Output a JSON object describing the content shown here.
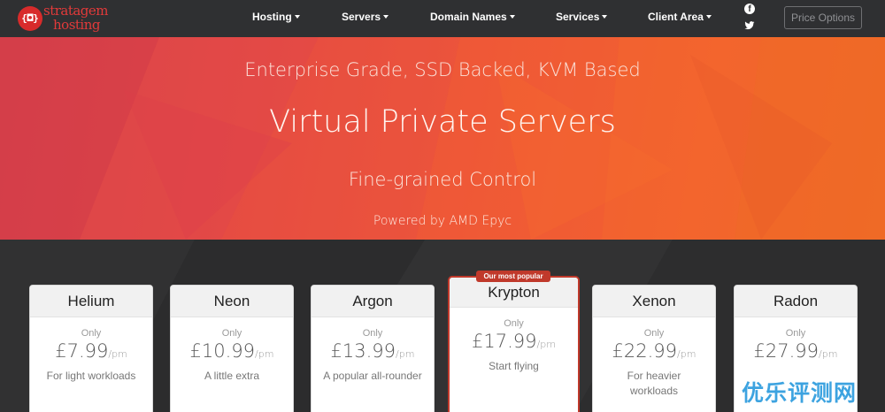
{
  "brand": {
    "name_line1": "stratagem",
    "name_line2": "hosting",
    "mark": "{◘}"
  },
  "nav": {
    "items": [
      {
        "label": "Hosting"
      },
      {
        "label": "Servers"
      },
      {
        "label": "Domain Names"
      },
      {
        "label": "Services"
      },
      {
        "label": "Client Area"
      }
    ],
    "social": [
      {
        "icon": "facebook-icon",
        "glyph": "f"
      },
      {
        "icon": "twitter-icon"
      }
    ],
    "price_options_label": "Price Options"
  },
  "hero": {
    "tagline": "Enterprise Grade, SSD Backed, KVM Based",
    "title": "Virtual Private Servers",
    "subtitle": "Fine-grained Control",
    "powered": "Powered by AMD Epyc"
  },
  "plans": [
    {
      "name": "Helium",
      "only": "Only",
      "price": "£7.99",
      "per": "/pm",
      "desc": "For light workloads"
    },
    {
      "name": "Neon",
      "only": "Only",
      "price": "£10.99",
      "per": "/pm",
      "desc": "A little extra"
    },
    {
      "name": "Argon",
      "only": "Only",
      "price": "£13.99",
      "per": "/pm",
      "desc": "A popular all-rounder"
    },
    {
      "name": "Krypton",
      "only": "Only",
      "price": "£17.99",
      "per": "/pm",
      "desc": "Start flying",
      "badge": "Our most popular"
    },
    {
      "name": "Xenon",
      "only": "Only",
      "price": "£22.99",
      "per": "/pm",
      "desc": "For heavier workloads"
    },
    {
      "name": "Radon",
      "only": "Only",
      "price": "£27.99",
      "per": "/pm",
      "desc": ""
    }
  ],
  "watermark": "优乐评测网",
  "colors": {
    "accent": "#c0392b",
    "navbar": "#2f3032",
    "hero_start": "#d7434b",
    "hero_end": "#ee6a26"
  }
}
